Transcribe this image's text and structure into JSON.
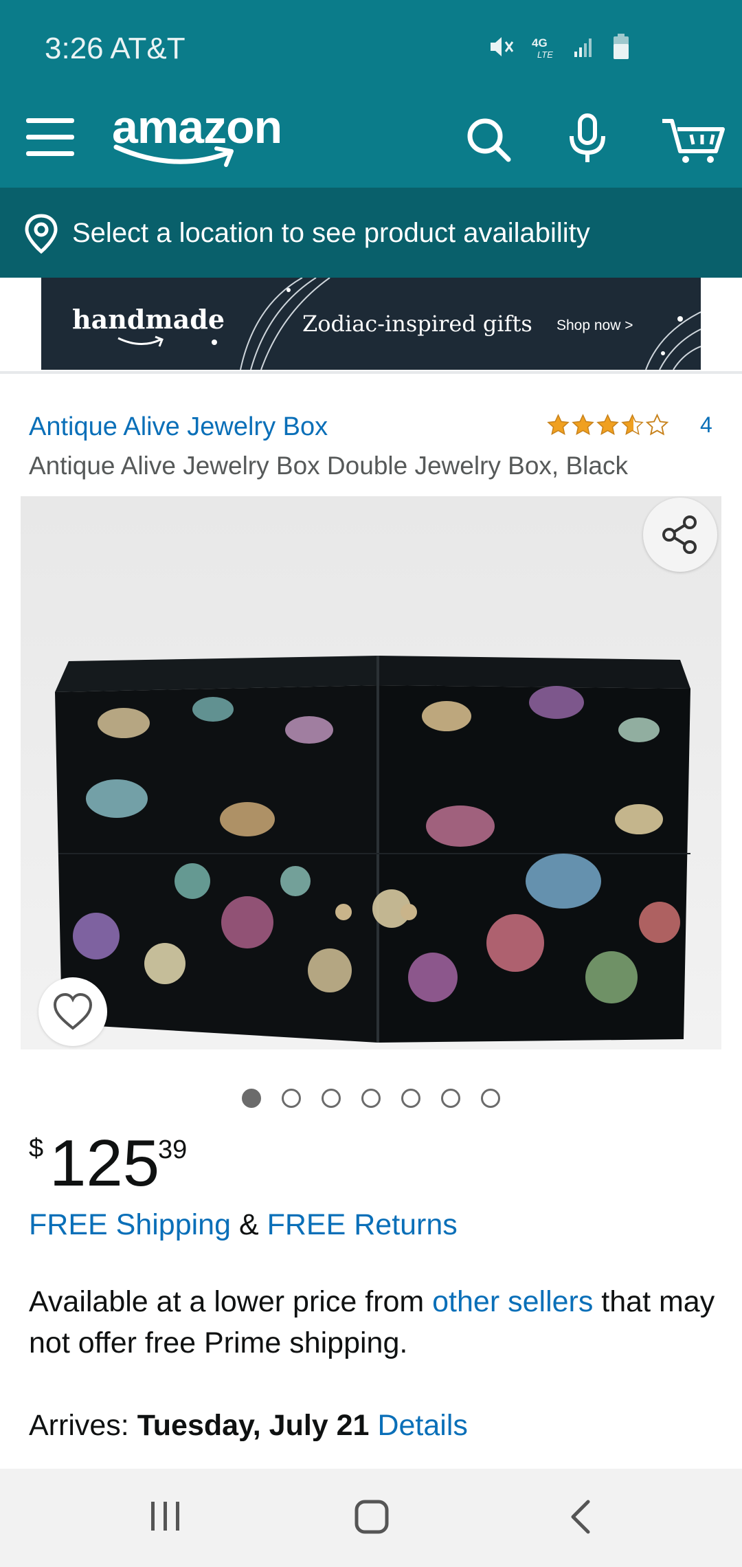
{
  "status_bar": {
    "time_carrier": "3:26 AT&T",
    "network": "4G LTE"
  },
  "header": {
    "logo": "amazon",
    "icons": [
      "menu-icon",
      "search-icon",
      "microphone-icon",
      "cart-icon"
    ]
  },
  "location": {
    "text": "Select a location to see product availability"
  },
  "banner": {
    "brand": "handmade",
    "title": "Zodiac-inspired gifts",
    "cta": "Shop now >"
  },
  "product": {
    "brand": "Antique Alive Jewelry Box",
    "rating_stars": 4.5,
    "rating_count": "4",
    "title": "Antique Alive Jewelry Box Double Jewelry Box, Black",
    "image_count": 7,
    "active_image": 1
  },
  "price": {
    "symbol": "$",
    "whole": "125",
    "fraction": "39"
  },
  "shipping": {
    "free_shipping": "FREE Shipping",
    "amp": "&",
    "free_returns": "FREE Returns"
  },
  "availability": {
    "prefix": "Available at a lower price from ",
    "link": "other sellers",
    "suffix": " that may not offer free Prime shipping."
  },
  "delivery": {
    "label": "Arrives:",
    "date": "Tuesday, July 21",
    "details": "Details"
  },
  "colors": {
    "header": "#0b7c8a",
    "location_bar": "#09606b",
    "link": "#0a6fb8",
    "star": "#f0a020"
  }
}
